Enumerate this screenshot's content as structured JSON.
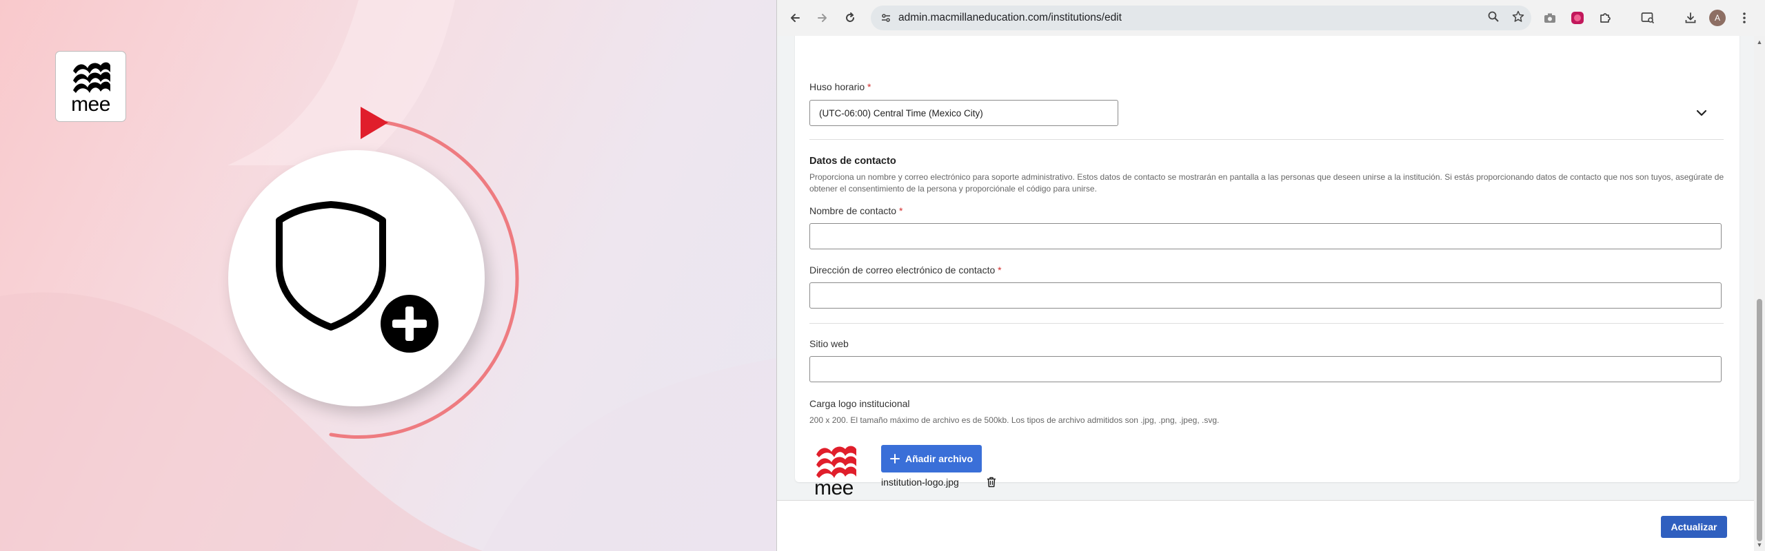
{
  "promo": {
    "logo_text": "mee",
    "logo_alt": "Macmillan Education mee logo"
  },
  "browser": {
    "url": "admin.macmillaneducation.com/institutions/edit",
    "profile_initial": "A"
  },
  "form": {
    "timezone": {
      "label": "Huso horario",
      "required_mark": "*",
      "value": "(UTC-06:00) Central Time (Mexico City)"
    },
    "contact_section": {
      "title": "Datos de contacto",
      "description": "Proporciona un nombre y correo electrónico para soporte administrativo. Estos datos de contacto se mostrarán en pantalla a las personas que deseen unirse a la institución. Si estás proporcionando datos de contacto que nos son tuyos, asegúrate de obtener el consentimiento de la persona y proporciónale el código para unirse."
    },
    "contact_name": {
      "label": "Nombre de contacto",
      "required_mark": "*",
      "value": ""
    },
    "contact_email": {
      "label": "Dirección de correo electrónico de contacto",
      "required_mark": "*",
      "value": ""
    },
    "website": {
      "label": "Sitio web",
      "value": ""
    },
    "logo_upload": {
      "label": "Carga logo institucional",
      "hint": "200 x 200. El tamaño máximo de archivo es de 500kb. Los tipos de archivo admitidos son .jpg, .png, .jpeg, .svg.",
      "add_button_label": "Añadir archivo",
      "file_name": "institution-logo.jpg",
      "preview_text": "mee"
    },
    "update_button_label": "Actualizar"
  },
  "colors": {
    "primary_button": "#3a6fd8",
    "required_mark": "#d32f2f",
    "brand_red": "#e01e2b"
  }
}
